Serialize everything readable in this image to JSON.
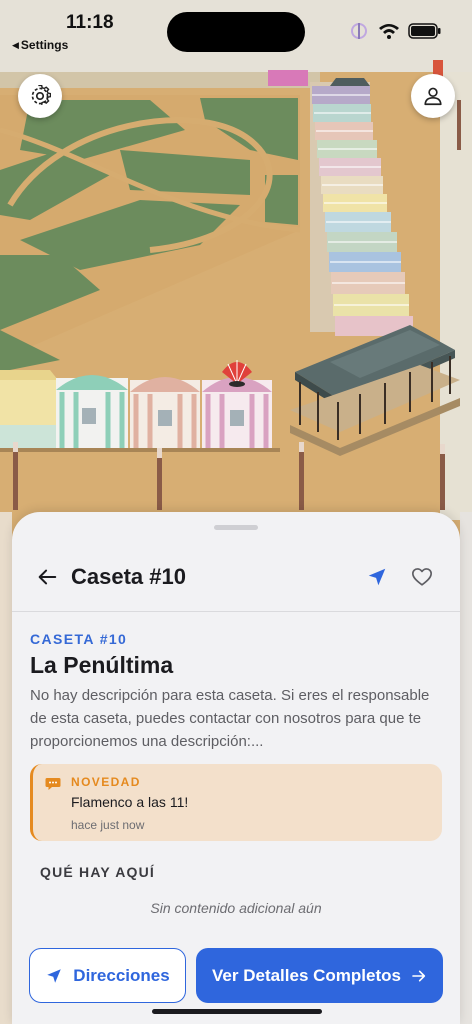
{
  "status_bar": {
    "time": "11:18",
    "back_label": "Settings"
  },
  "map": {
    "buttons": {
      "settings_icon": "gear-icon",
      "profile_icon": "person-icon"
    }
  },
  "sheet": {
    "title": "Caseta #10",
    "eyebrow": "CASETA #10",
    "name": "La Penúltima",
    "description": "No hay descripción para esta caseta. Si eres el responsable de esta caseta, puedes contactar con nosotros para que te proporcionemos una descripción:...",
    "news": {
      "label": "NOVEDAD",
      "text": "Flamenco a las 11!",
      "time": "hace just now"
    },
    "section_title": "QUÉ HAY AQUÍ",
    "empty_text": "Sin contenido adicional aún",
    "directions_label": "Direcciones",
    "details_label": "Ver Detalles Completos",
    "icons": {
      "back": "arrow-left-icon",
      "navigate": "location-arrow-icon",
      "favorite": "heart-icon",
      "news": "chat-bubble-icon",
      "details": "arrow-right-icon"
    }
  },
  "colors": {
    "accent": "#2f66dd",
    "eyebrow": "#3569d6",
    "news_accent": "#e58a1f",
    "news_bg": "#f3e0cb",
    "ground": "#d6ad72",
    "lawn": "#6b8e5e"
  }
}
